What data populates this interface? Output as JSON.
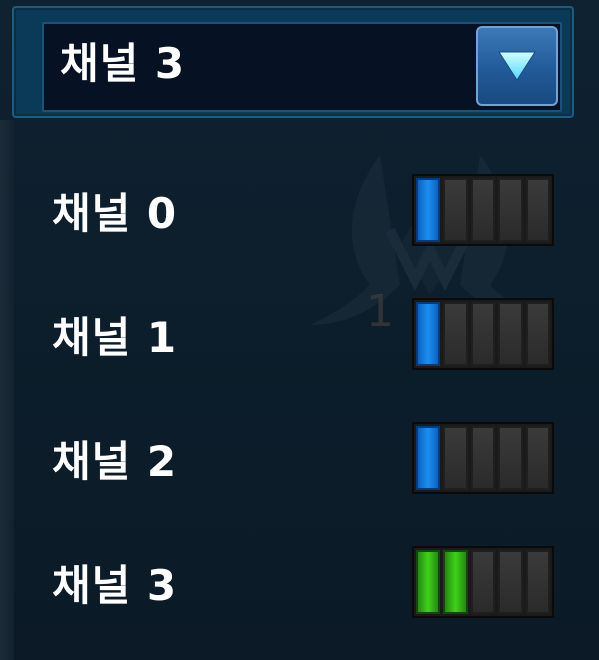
{
  "dropdown": {
    "selected": "채널 3",
    "arrow_icon": "triangle-down-icon"
  },
  "channels": [
    {
      "label": "채널 0",
      "level_segments": 1,
      "total_segments": 5,
      "color": "#1c8ff0"
    },
    {
      "label": "채널 1",
      "level_segments": 1,
      "total_segments": 5,
      "color": "#1c8ff0"
    },
    {
      "label": "채널 2",
      "level_segments": 1,
      "total_segments": 5,
      "color": "#1c8ff0"
    },
    {
      "label": "채널 3",
      "level_segments": 2,
      "total_segments": 5,
      "color": "#3fd11a"
    }
  ],
  "background_deco": {
    "text": "1"
  }
}
